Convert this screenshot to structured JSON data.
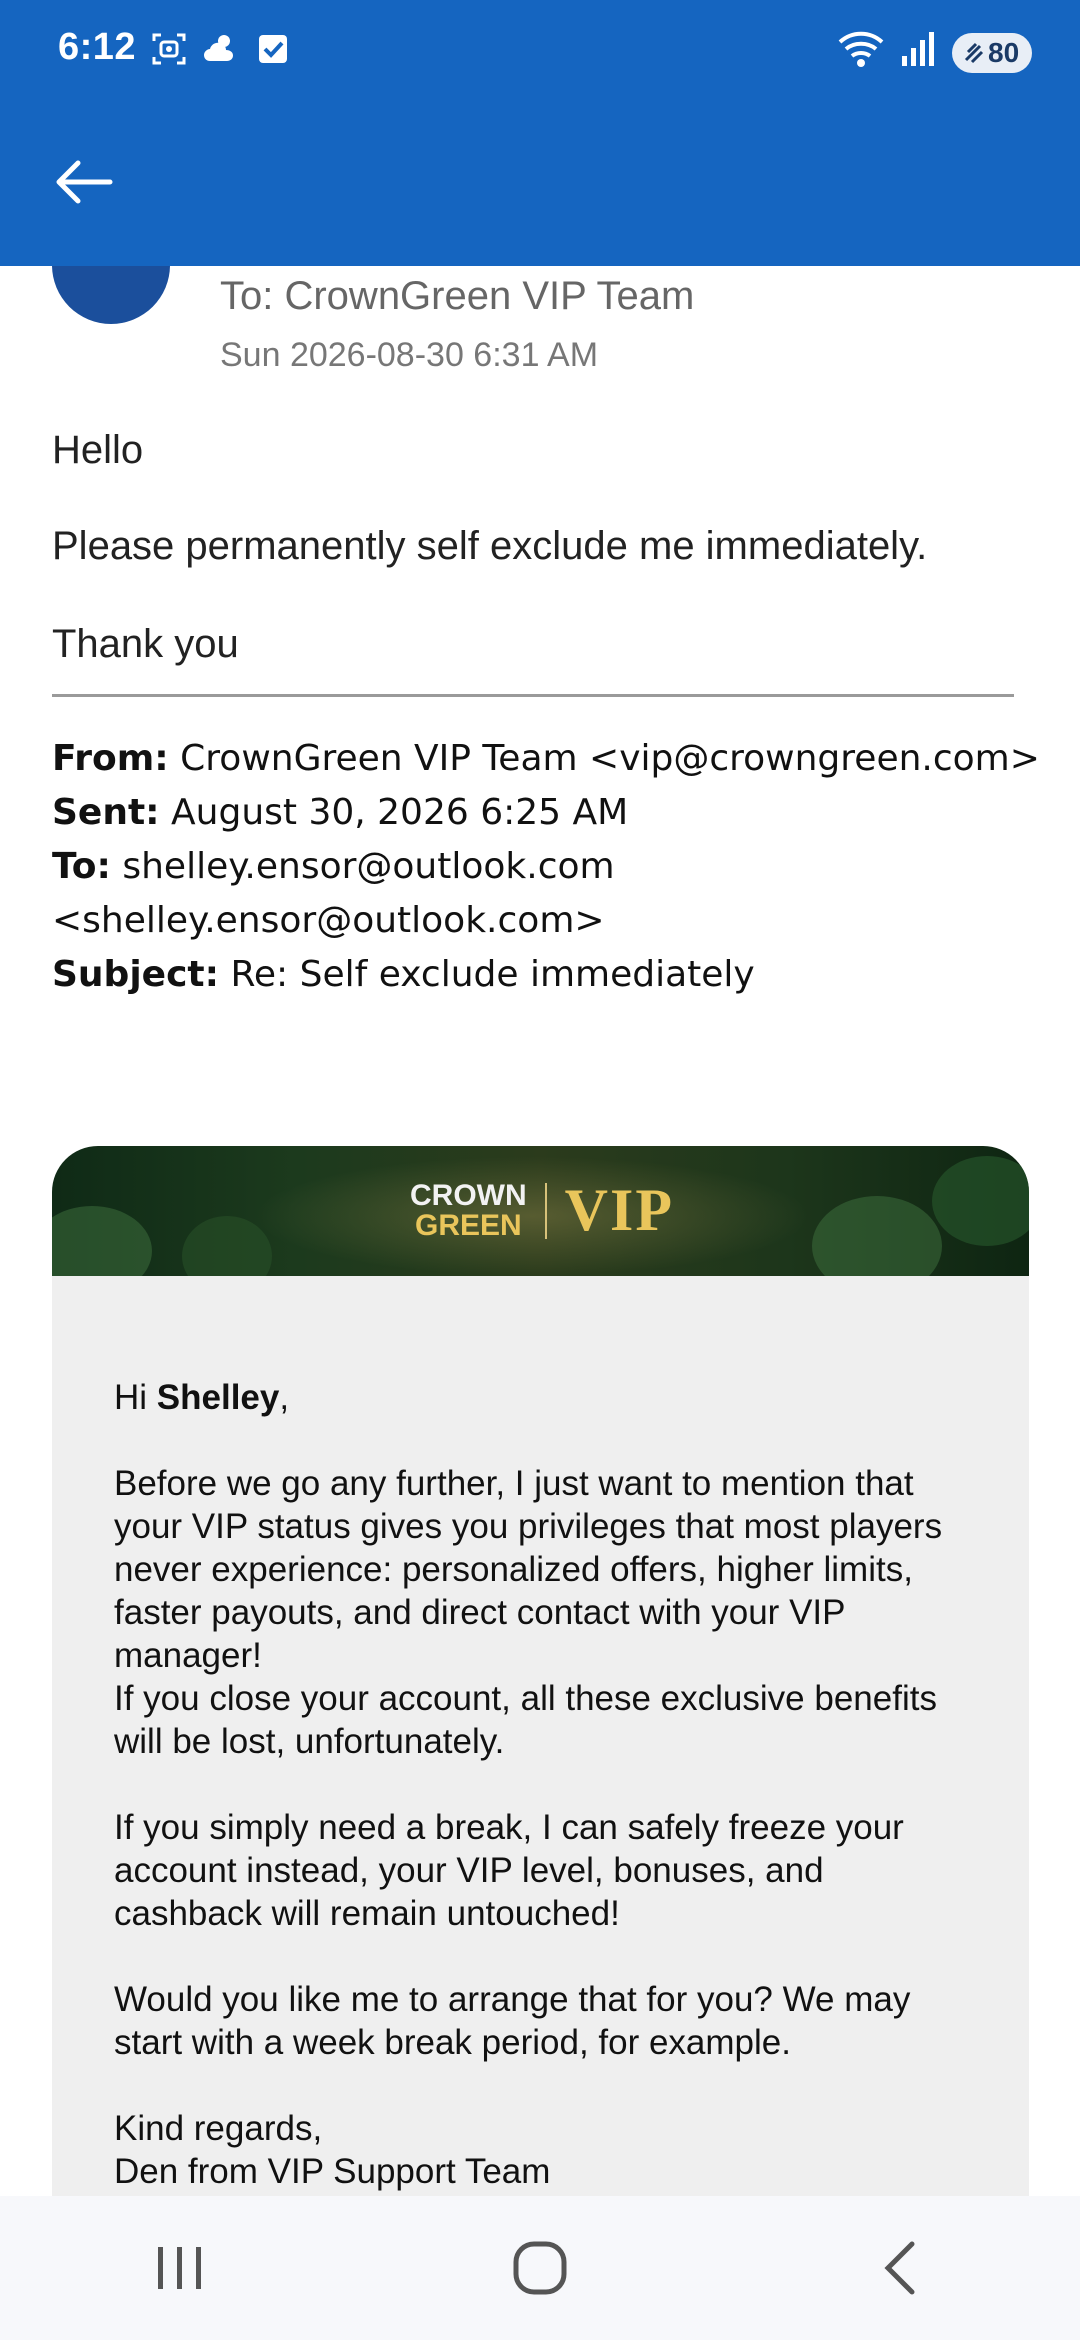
{
  "status_bar": {
    "time": "6:12",
    "battery": "80"
  },
  "header": {
    "back_icon": "arrow-left-icon"
  },
  "email": {
    "to": "To: CrownGreen VIP Team",
    "date": "Sun 2026-08-30 6:31 AM",
    "body": {
      "greeting": "Hello",
      "line1": "Please permanently self exclude me immediately.",
      "signoff": "Thank you"
    },
    "quoted_header": {
      "from_label": "From:",
      "from_value": "CrownGreen VIP Team <vip@crowngreen.com>",
      "sent_label": "Sent:",
      "sent_value": "August 30, 2026 6:25 AM",
      "to_label": "To:",
      "to_value": "shelley.ensor@outlook.com <shelley.ensor@outlook.com>",
      "subject_label": "Subject:",
      "subject_value": "Re: Self exclude immediately"
    }
  },
  "vip_card": {
    "logo_line1": "CROWN",
    "logo_line2": "GREEN",
    "logo_vip": "VIP",
    "greeting_prefix": "Hi ",
    "greeting_name": "Shelley",
    "greeting_suffix": ",",
    "para1a": "Before we go any further, I just want to mention that your VIP status gives you privileges that most players never experience: personalized offers, higher limits, faster payouts, and direct contact with your VIP manager!",
    "para1b": "If you close your account, all these exclusive benefits will be lost, unfortunately.",
    "para2": "If you simply need a break, I can safely freeze your account instead, your VIP level, bonuses, and cashback will remain untouched!",
    "para3": "Would you like me to arrange that for you? We may start with a week break period, for example.",
    "closing": "Kind regards,",
    "signature": "Den from VIP Support Team"
  },
  "nav": {
    "recents_icon": "recents-icon",
    "home_icon": "home-icon",
    "back_icon": "back-chevron-icon"
  },
  "colors": {
    "appbar": "#1565c0",
    "card_bg": "#efefef",
    "gold": "#e9c55b"
  }
}
